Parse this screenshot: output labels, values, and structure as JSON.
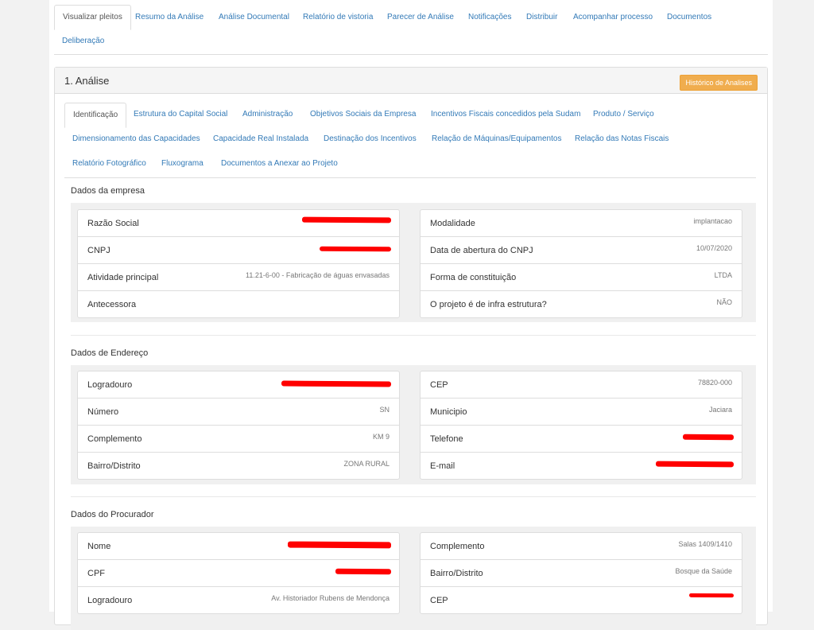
{
  "top_tabs": [
    {
      "label": "Visualizar pleitos"
    },
    {
      "label": "Resumo da Análise"
    },
    {
      "label": "Análise Documental"
    },
    {
      "label": "Relatório de vistoria"
    },
    {
      "label": "Parecer de Análise"
    },
    {
      "label": "Notificações"
    },
    {
      "label": "Distribuir"
    },
    {
      "label": "Acompanhar processo"
    },
    {
      "label": "Documentos"
    },
    {
      "label": "Deliberação"
    }
  ],
  "panel": {
    "title": "1. Análise",
    "history_button": "Histórico de Analises"
  },
  "inner_tabs": [
    {
      "label": "Identificação"
    },
    {
      "label": "Estrutura do Capital Social"
    },
    {
      "label": "Administração"
    },
    {
      "label": "Objetivos Sociais da Empresa"
    },
    {
      "label": "Incentivos Fiscais concedidos pela Sudam"
    },
    {
      "label": "Produto / Serviço"
    },
    {
      "label": "Dimensionamento das Capacidades"
    },
    {
      "label": "Capacidade Real Instalada"
    },
    {
      "label": "Destinação dos Incentivos"
    },
    {
      "label": "Relação de Máquinas/Equipamentos"
    },
    {
      "label": "Relação das Notas Fiscais"
    },
    {
      "label": "Relatório Fotográfico"
    },
    {
      "label": "Fluxograma"
    },
    {
      "label": "Documentos a Anexar ao Projeto"
    }
  ],
  "sections": {
    "empresa": {
      "title": "Dados da empresa",
      "left": [
        {
          "label": "Razão Social",
          "value": ""
        },
        {
          "label": "CNPJ",
          "value": ""
        },
        {
          "label": "Atividade principal",
          "value": "11.21-6-00 - Fabricação de águas envasadas"
        },
        {
          "label": "Antecessora",
          "value": ""
        }
      ],
      "right": [
        {
          "label": "Modalidade",
          "value": "implantacao"
        },
        {
          "label": "Data de abertura do CNPJ",
          "value": "10/07/2020"
        },
        {
          "label": "Forma de constituição",
          "value": "LTDA"
        },
        {
          "label": "O projeto é de infra estrutura?",
          "value": "NÃO"
        }
      ]
    },
    "endereco": {
      "title": "Dados de Endereço",
      "left": [
        {
          "label": "Logradouro",
          "value": ""
        },
        {
          "label": "Número",
          "value": "SN"
        },
        {
          "label": "Complemento",
          "value": "KM 9"
        },
        {
          "label": "Bairro/Distrito",
          "value": "ZONA RURAL"
        }
      ],
      "right": [
        {
          "label": "CEP",
          "value": "78820-000"
        },
        {
          "label": "Municipio",
          "value": "Jaciara"
        },
        {
          "label": "Telefone",
          "value": ""
        },
        {
          "label": "E-mail",
          "value": ""
        }
      ]
    },
    "procurador": {
      "title": "Dados do Procurador",
      "left": [
        {
          "label": "Nome",
          "value": ""
        },
        {
          "label": "CPF",
          "value": ""
        },
        {
          "label": "Logradouro",
          "value": "Av. Historiador Rubens de Mendonça"
        }
      ],
      "right": [
        {
          "label": "Complemento",
          "value": "Salas 1409/1410"
        },
        {
          "label": "Bairro/Distrito",
          "value": "Bosque da Saúde"
        },
        {
          "label": "CEP",
          "value": ""
        }
      ]
    }
  },
  "colors": {
    "link": "#337ab7",
    "warning_button": "#f0ad4e",
    "redaction": "#ff0000"
  }
}
